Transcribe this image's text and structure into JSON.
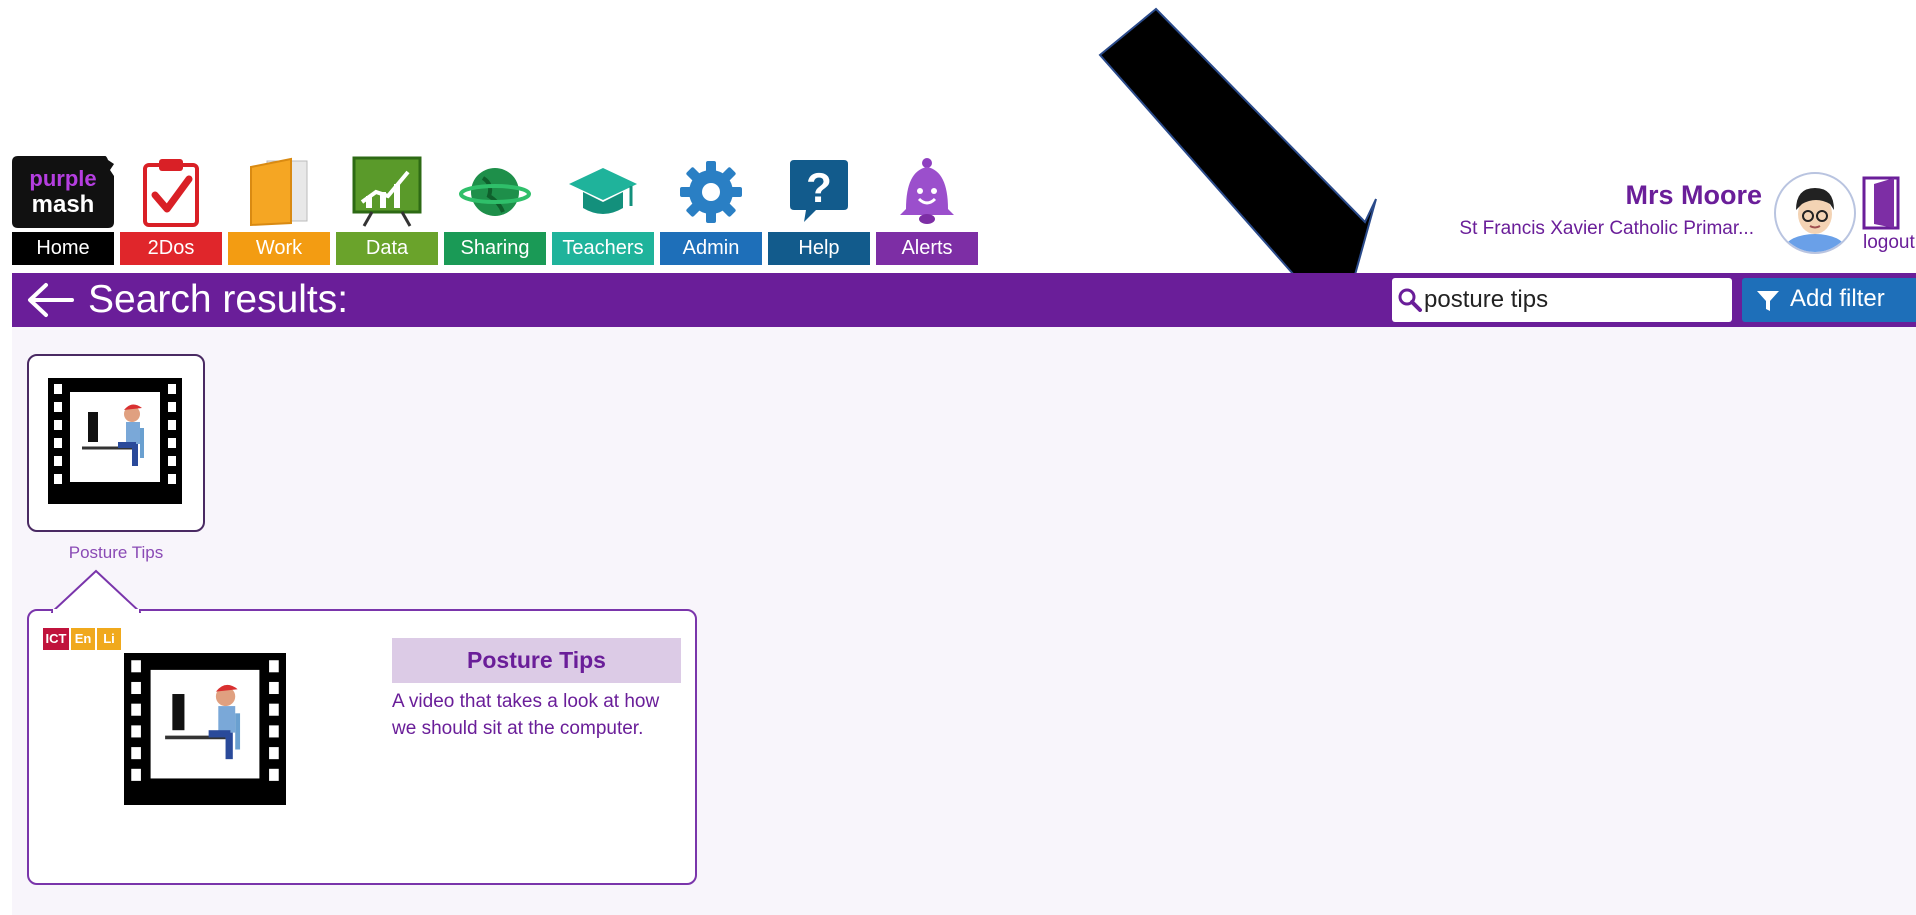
{
  "nav": {
    "logo_top": "purple",
    "logo_bottom": "mash",
    "items": [
      {
        "label": "Home",
        "color": "#000000"
      },
      {
        "label": "2Dos",
        "color": "#e0262b"
      },
      {
        "label": "Work",
        "color": "#f39c12"
      },
      {
        "label": "Data",
        "color": "#6aa32b"
      },
      {
        "label": "Sharing",
        "color": "#1a9a56"
      },
      {
        "label": "Teachers",
        "color": "#1fb39b"
      },
      {
        "label": "Admin",
        "color": "#1e6fb9"
      },
      {
        "label": "Help",
        "color": "#125b8c"
      },
      {
        "label": "Alerts",
        "color": "#7d2ea5"
      }
    ]
  },
  "user": {
    "name": "Mrs Moore",
    "school": "St Francis Xavier Catholic Primar...",
    "logout_label": "logout"
  },
  "header": {
    "title": "Search results:",
    "search_value": "posture tips",
    "add_filter_label": "Add filter"
  },
  "results": [
    {
      "label": "Posture Tips"
    }
  ],
  "detail": {
    "subjects": [
      {
        "code": "ICT",
        "color": "#c0133c"
      },
      {
        "code": "En",
        "color": "#f0a91c"
      },
      {
        "code": "Li",
        "color": "#f0a91c"
      }
    ],
    "title": "Posture Tips",
    "description": "A video that takes a look at how we should sit at the computer."
  },
  "colors": {
    "brand_purple": "#6a1e99",
    "filter_blue": "#1e6fb9"
  }
}
